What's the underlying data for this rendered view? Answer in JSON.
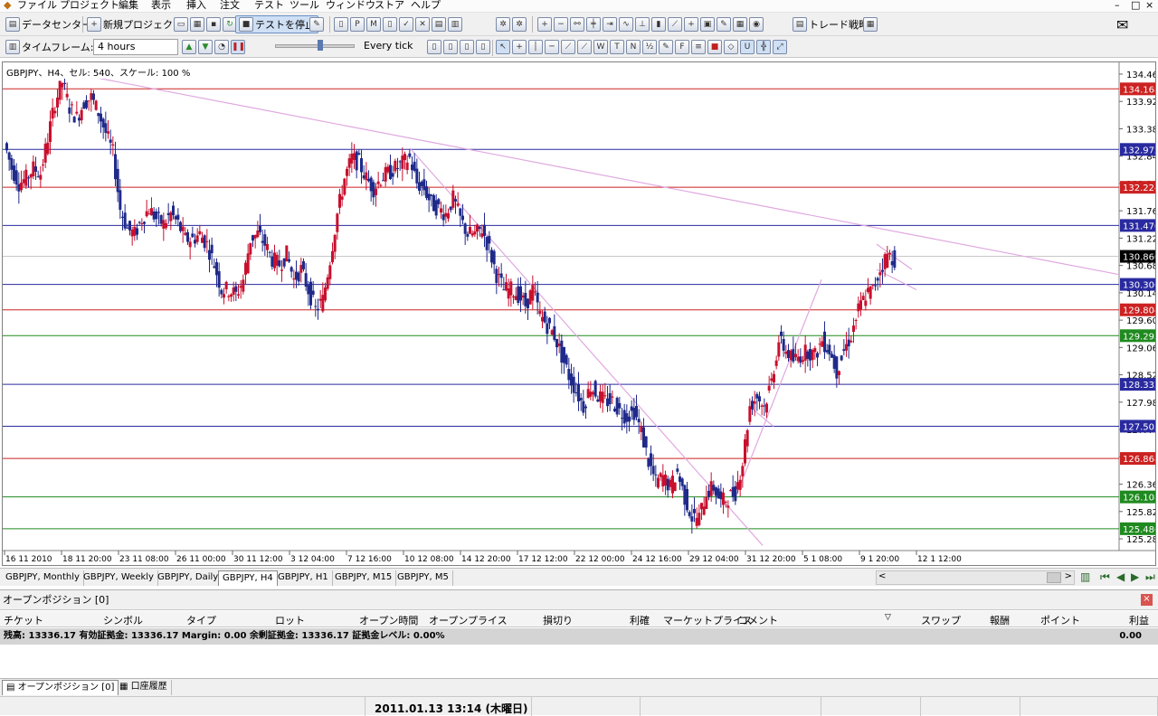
{
  "menu": [
    "ファイル",
    "プロジェクト",
    "編集",
    "表示",
    "挿入",
    "注文",
    "テスト",
    "ツール",
    "ウィンドウ",
    "ストア",
    "ヘルプ"
  ],
  "toolbar1": {
    "data_center": "データセンター",
    "new_project": "新規プロジェクト",
    "stop_test": "テストを停止",
    "trade_strategy": "トレード戦略"
  },
  "toolbar2": {
    "timeframe_label": "タイムフレーム:",
    "timeframe_value": "4 hours",
    "tick_value": "Every tick"
  },
  "chart_data": {
    "type": "candlestick",
    "header": "GBPJPY、H4、セル: 540、スケール: 100 %",
    "y_ticks": [
      "134.460",
      "133.920",
      "133.380",
      "132.840",
      "132.300",
      "131.760",
      "131.220",
      "130.680",
      "130.140",
      "129.600",
      "129.060",
      "128.520",
      "127.980",
      "127.440",
      "126.900",
      "126.360",
      "125.820",
      "125.280"
    ],
    "x_ticks": [
      "16 11 2010",
      "18 11 20:00",
      "23 11 08:00",
      "26 11 00:00",
      "30 11 12:00",
      "3 12 04:00",
      "7 12 16:00",
      "10 12 08:00",
      "14 12 20:00",
      "17 12 12:00",
      "22 12 00:00",
      "24 12 16:00",
      "29 12 04:00",
      "31 12 20:00",
      "5 1 08:00",
      "9 1 20:00",
      "12 1 12:00"
    ],
    "y_range": [
      125.12,
      134.62
    ],
    "horizontal_lines": [
      {
        "price": 134.168,
        "label": "134.168",
        "color": "#cc2222"
      },
      {
        "price": 132.972,
        "label": "132.972",
        "color": "#2a2aa0"
      },
      {
        "price": 132.224,
        "label": "132.224",
        "color": "#cc2222"
      },
      {
        "price": 131.47,
        "label": "131.470",
        "color": "#2a2aa0"
      },
      {
        "price": 130.306,
        "label": "130.306",
        "color": "#2a2aa0"
      },
      {
        "price": 129.804,
        "label": "129.804",
        "color": "#cc2222"
      },
      {
        "price": 129.293,
        "label": "129.293",
        "color": "#1f8a1f"
      },
      {
        "price": 128.332,
        "label": "128.332",
        "color": "#2a2aa0"
      },
      {
        "price": 127.505,
        "label": "127.505",
        "color": "#2a2aa0"
      },
      {
        "price": 126.868,
        "label": "126.868",
        "color": "#cc2222"
      },
      {
        "price": 126.108,
        "label": "126.108",
        "color": "#1f8a1f"
      },
      {
        "price": 125.48,
        "label": "125.480",
        "color": "#1f8a1f"
      }
    ],
    "current_price": {
      "price": 130.86,
      "label": "130.860"
    },
    "path_points": [
      [
        0,
        133.1
      ],
      [
        8,
        132.6
      ],
      [
        16,
        132.3
      ],
      [
        24,
        132.4
      ],
      [
        32,
        132.6
      ],
      [
        40,
        132.5
      ],
      [
        48,
        133.2
      ],
      [
        56,
        133.9
      ],
      [
        64,
        134.3
      ],
      [
        72,
        133.8
      ],
      [
        80,
        133.6
      ],
      [
        88,
        133.9
      ],
      [
        96,
        134.0
      ],
      [
        104,
        133.7
      ],
      [
        112,
        133.3
      ],
      [
        120,
        132.9
      ],
      [
        128,
        131.8
      ],
      [
        136,
        131.4
      ],
      [
        144,
        131.3
      ],
      [
        152,
        131.6
      ],
      [
        160,
        131.8
      ],
      [
        168,
        131.6
      ],
      [
        176,
        131.5
      ],
      [
        184,
        131.7
      ],
      [
        192,
        131.5
      ],
      [
        200,
        131.2
      ],
      [
        208,
        131.2
      ],
      [
        216,
        131.3
      ],
      [
        224,
        131.1
      ],
      [
        232,
        130.7
      ],
      [
        240,
        130.2
      ],
      [
        248,
        130.2
      ],
      [
        256,
        130.1
      ],
      [
        264,
        130.4
      ],
      [
        272,
        131.2
      ],
      [
        280,
        131.3
      ],
      [
        288,
        131.1
      ],
      [
        296,
        130.8
      ],
      [
        304,
        130.7
      ],
      [
        312,
        130.9
      ],
      [
        320,
        130.4
      ],
      [
        328,
        130.6
      ],
      [
        336,
        130.2
      ],
      [
        344,
        129.8
      ],
      [
        352,
        130.0
      ],
      [
        360,
        130.8
      ],
      [
        368,
        131.7
      ],
      [
        376,
        132.4
      ],
      [
        384,
        132.8
      ],
      [
        392,
        132.7
      ],
      [
        400,
        132.4
      ],
      [
        408,
        132.2
      ],
      [
        416,
        132.4
      ],
      [
        424,
        132.5
      ],
      [
        432,
        132.6
      ],
      [
        440,
        132.7
      ],
      [
        448,
        132.8
      ],
      [
        456,
        132.3
      ],
      [
        464,
        132.2
      ],
      [
        472,
        131.9
      ],
      [
        480,
        131.8
      ],
      [
        488,
        131.7
      ],
      [
        496,
        132.0
      ],
      [
        504,
        131.6
      ],
      [
        512,
        131.3
      ],
      [
        520,
        131.3
      ],
      [
        528,
        131.4
      ],
      [
        536,
        131.0
      ],
      [
        544,
        130.5
      ],
      [
        552,
        130.2
      ],
      [
        560,
        130.2
      ],
      [
        568,
        130.1
      ],
      [
        576,
        129.9
      ],
      [
        584,
        130.2
      ],
      [
        592,
        129.7
      ],
      [
        600,
        129.5
      ],
      [
        608,
        129.3
      ],
      [
        616,
        128.9
      ],
      [
        624,
        128.5
      ],
      [
        632,
        128.2
      ],
      [
        640,
        127.9
      ],
      [
        648,
        128.3
      ],
      [
        656,
        128.1
      ],
      [
        664,
        128.0
      ],
      [
        672,
        128.0
      ],
      [
        680,
        127.8
      ],
      [
        688,
        127.7
      ],
      [
        696,
        127.8
      ],
      [
        704,
        127.4
      ],
      [
        712,
        126.8
      ],
      [
        720,
        126.4
      ],
      [
        728,
        126.5
      ],
      [
        736,
        126.3
      ],
      [
        744,
        126.6
      ],
      [
        752,
        126.1
      ],
      [
        760,
        125.7
      ],
      [
        768,
        125.7
      ],
      [
        776,
        126.2
      ],
      [
        784,
        126.3
      ],
      [
        792,
        126.0
      ],
      [
        800,
        126.1
      ],
      [
        808,
        126.2
      ],
      [
        816,
        126.8
      ],
      [
        824,
        127.9
      ],
      [
        832,
        128.1
      ],
      [
        840,
        127.9
      ],
      [
        848,
        128.4
      ],
      [
        856,
        129.2
      ],
      [
        864,
        129.0
      ],
      [
        872,
        128.8
      ],
      [
        880,
        128.9
      ],
      [
        888,
        129.0
      ],
      [
        896,
        128.9
      ],
      [
        904,
        129.2
      ],
      [
        912,
        129.0
      ],
      [
        920,
        128.6
      ],
      [
        928,
        129.0
      ],
      [
        936,
        129.3
      ],
      [
        944,
        129.8
      ],
      [
        952,
        130.1
      ],
      [
        960,
        130.2
      ],
      [
        968,
        130.6
      ],
      [
        976,
        130.9
      ],
      [
        984,
        130.8
      ]
    ]
  },
  "tabs": [
    "GBPJPY, Monthly",
    "GBPJPY, Weekly",
    "GBPJPY, Daily",
    "GBPJPY, H4",
    "GBPJPY, H1",
    "GBPJPY, M15",
    "GBPJPY, M5"
  ],
  "terminal": {
    "title": "オープンポジション [0]",
    "columns": [
      "チケット",
      "シンボル",
      "タイプ",
      "ロット",
      "オープン時間",
      "オープンプライス",
      "損切り",
      "利確",
      "マーケットプライス",
      "コメント",
      "スワップ",
      "報酬",
      "ポイント",
      "利益"
    ],
    "balance": "残高: 13336.17 有効証拠金: 13336.17 Margin: 0.00 余剰証拠金: 13336.17 証拠金レベル: 0.00%",
    "balance_value": "0.00"
  },
  "bottom_tabs": [
    "オープンポジション [0]",
    "口座履歴"
  ],
  "status": {
    "datetime": "2011.01.13 13:14 (木曜日)"
  }
}
